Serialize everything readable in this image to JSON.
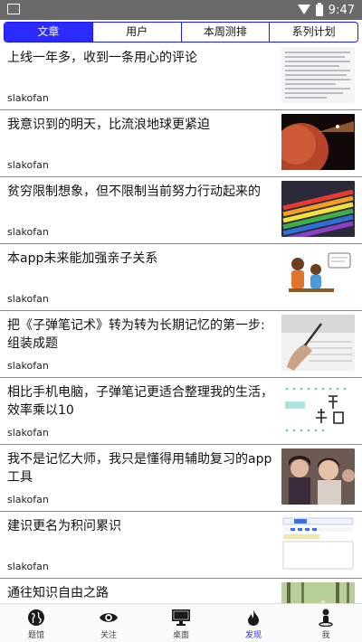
{
  "status_bar": {
    "time": "9:47"
  },
  "tabs": [
    {
      "label": "文章",
      "active": true
    },
    {
      "label": "用户",
      "active": false
    },
    {
      "label": "本周测排",
      "active": false
    },
    {
      "label": "系列计划",
      "active": false
    }
  ],
  "articles": [
    {
      "title": "上线一年多，收到一条用心的评论",
      "author": "slakofan",
      "thumb_icon": "text-screenshot"
    },
    {
      "title": "我意识到的明天，比流浪地球更紧迫",
      "author": "slakofan",
      "thumb_icon": "planet-image"
    },
    {
      "title": "贫穷限制想象，但不限制当前努力行动起来的",
      "author": "slakofan",
      "thumb_icon": "colored-pencils-image"
    },
    {
      "title": "本app未来能加强亲子关系",
      "author": "slakofan",
      "thumb_icon": "parent-child-illustration"
    },
    {
      "title": "把《子弹笔记术》转为转为长期记忆的第一步:组装成题",
      "author": "slakofan",
      "thumb_icon": "writing-hand-image"
    },
    {
      "title": "相比手机电脑，子弹笔记更适合整理我的生活，效率乘以10",
      "author": "slakofan",
      "thumb_icon": "bullet-journal-image"
    },
    {
      "title": "我不是记忆大师，我只是懂得用辅助复习的app工具",
      "author": "slakofan",
      "thumb_icon": "people-photo"
    },
    {
      "title": "建识更名为积问累识",
      "author": "slakofan",
      "thumb_icon": "app-screenshot"
    },
    {
      "title": "通往知识自由之路",
      "author": "",
      "thumb_icon": "forest-path-image"
    }
  ],
  "bottom_nav": [
    {
      "label": "题馆",
      "icon": "globe-icon",
      "active": false
    },
    {
      "label": "关注",
      "icon": "eye-icon",
      "active": false
    },
    {
      "label": "桌面",
      "icon": "monitor-icon",
      "active": false
    },
    {
      "label": "发现",
      "icon": "flame-icon",
      "active": true
    },
    {
      "label": "我",
      "icon": "person-icon",
      "active": false
    }
  ],
  "colors": {
    "accent": "#2b2bff",
    "status_bar": "#6a6a6a",
    "divider": "#8a8a8a"
  }
}
